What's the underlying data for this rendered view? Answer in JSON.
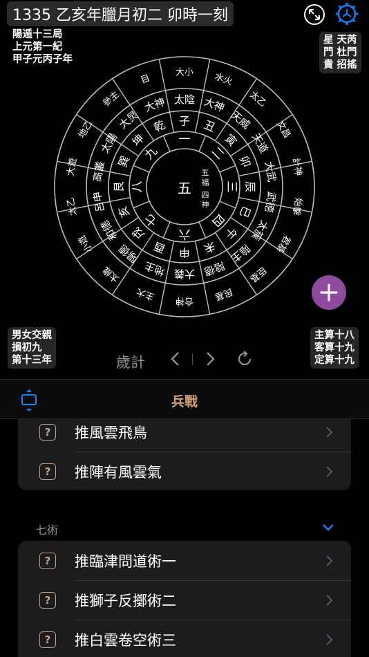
{
  "header": {
    "title": "1335 乙亥年臘月初二 卯時一刻"
  },
  "top_left_info": [
    "陽遁十三局",
    "上元第一紀",
    "甲子元丙子年"
  ],
  "top_right_info": [
    "星 天芮",
    "門 杜門",
    "貴 招搖"
  ],
  "bottom_left_info": [
    "男女交親",
    "損初九",
    "第十三年"
  ],
  "bottom_right_info": [
    "主算十八",
    "客算十九",
    "定算十九"
  ],
  "wheel": {
    "center": "五",
    "center_side": [
      "五",
      "福",
      "四",
      "神"
    ],
    "numbers_ring": [
      "一",
      "二",
      "三",
      "四",
      "六",
      "七",
      "八",
      "九"
    ],
    "branches_ring": [
      "子",
      "丑",
      "寅",
      "卯",
      "辰",
      "巳",
      "午",
      "未",
      "申",
      "酉",
      "戌",
      "亥",
      "艮",
      "巽",
      "坤",
      "乾"
    ],
    "gods_ring": [
      "太陰",
      "大神",
      "天威",
      "天道",
      "大武",
      "武德",
      "太簇",
      "陰主",
      "陰德",
      "大義",
      "地主",
      "陽德",
      "和德",
      "呂申",
      "高叢",
      "太陽",
      "大炅",
      "大神"
    ],
    "outer_ring": [
      "大小",
      "水火",
      "太乙",
      "文昌",
      "計神",
      "始擊",
      "君基",
      "臣基",
      "民基",
      "合神",
      "主大",
      "太歲",
      "小遊",
      "太乙",
      "大遊",
      "地乙",
      "參主",
      "目"
    ]
  },
  "controls": {
    "mode_label": "歲計"
  },
  "toolbar": {
    "title": "兵戰"
  },
  "card1": {
    "items": [
      "推風雲飛鳥",
      "推陣有風雲氣"
    ]
  },
  "section": {
    "header": "七術"
  },
  "card2": {
    "items": [
      "推臨津問道術一",
      "推獅子反擲術二",
      "推白雲卷空術三"
    ]
  },
  "colors": {
    "accent": "#d2a07a",
    "fab": "#8e4b9e",
    "link_blue": "#0a84ff"
  }
}
